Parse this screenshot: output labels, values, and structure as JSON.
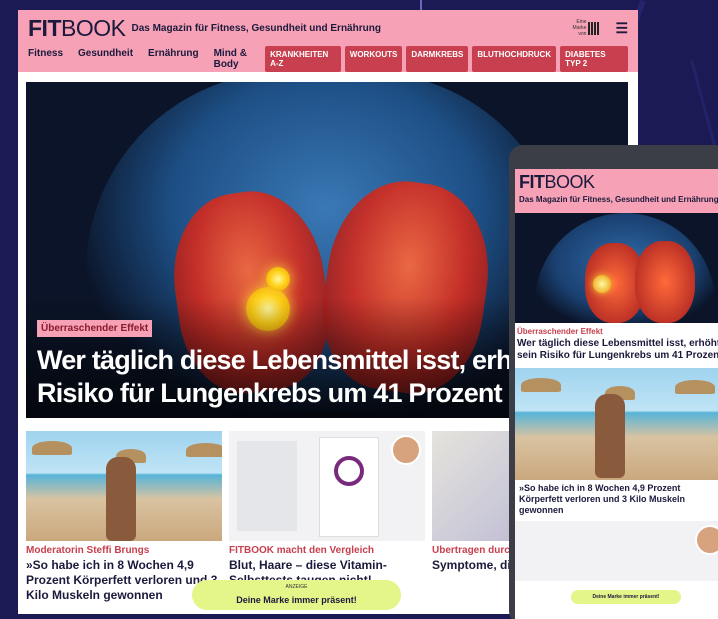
{
  "site": {
    "logo_bold": "FIT",
    "logo_light": "BOOK",
    "tagline": "Das Magazin für Fitness, Gesundheit und Ernährung",
    "brand_mark_text": "Eine Marke von"
  },
  "nav": {
    "items": [
      "Fitness",
      "Gesundheit",
      "Ernährung",
      "Mind & Body"
    ],
    "pills": [
      "KRANKHEITEN A-Z",
      "WORKOUTS",
      "DARMKREBS",
      "BLUTHOCHDRUCK",
      "DIABETES TYP 2"
    ]
  },
  "hero": {
    "kicker": "Überraschender Effekt",
    "title_line1": "Wer täglich diese Lebensmittel isst, erhöht",
    "title_line2": "Risiko für Lungenkrebs um 41 Prozent"
  },
  "cards": [
    {
      "kicker": "Moderatorin Steffi Brungs",
      "title": "»So habe ich in 8 Wochen 4,9 Prozent Körperfett verloren und 3 Kilo Muskeln gewonnen"
    },
    {
      "kicker": "FITBOOK macht den Vergleich",
      "title": "Blut, Haare – diese Vitamin-Selbsttests taugen nicht!"
    },
    {
      "kicker": "Übertragen durch Z",
      "title": "Symptome, die a hindeuten"
    }
  ],
  "ad": {
    "label": "ANZEIGE",
    "text": "Deine Marke immer präsent!"
  },
  "mobile": {
    "kicker": "Überraschender Effekt",
    "title": "Wer täglich diese Lebensmittel isst, erhöht sein Risiko für Lungenkrebs um 41 Prozent",
    "card_title": "»So habe ich in 8 Wochen 4,9 Prozent Körperfett verloren und 3 Kilo Muskeln gewonnen",
    "ad_text": "Deine Marke immer präsent!"
  },
  "colors": {
    "header_pink": "#f6a1b6",
    "accent_red": "#c8404f",
    "navy": "#1b1a3d",
    "ad_lime": "#e4f58a",
    "background": "#1c1a55"
  }
}
